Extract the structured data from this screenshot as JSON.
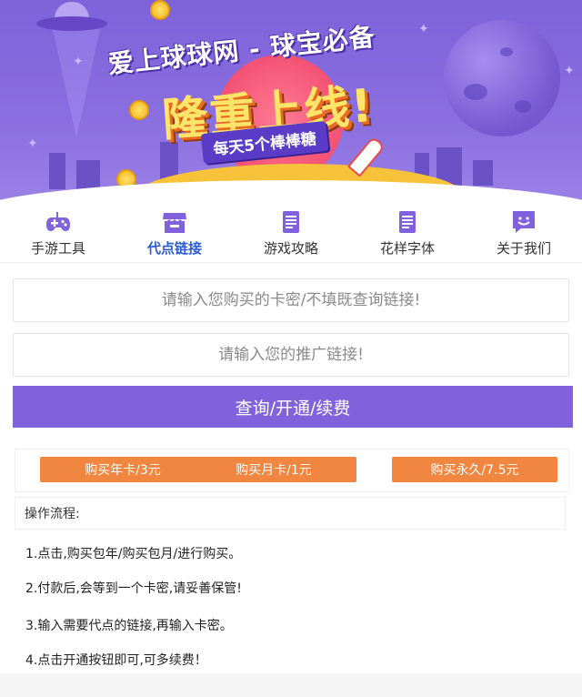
{
  "banner": {
    "title": "爱上球球网 - 球宝必备",
    "headline": "隆重上线!",
    "ribbon": "每天5个棒棒糖"
  },
  "nav": {
    "items": [
      {
        "label": "手游工具",
        "icon": "gamepad-icon",
        "active": false
      },
      {
        "label": "代点链接",
        "icon": "shop-icon",
        "active": true
      },
      {
        "label": "游戏攻略",
        "icon": "document-icon",
        "active": false
      },
      {
        "label": "花样字体",
        "icon": "document-icon",
        "active": false
      },
      {
        "label": "关于我们",
        "icon": "chat-smile-icon",
        "active": false
      }
    ],
    "accent": "#8162dc",
    "active_color": "#2a5bd6"
  },
  "form": {
    "card_placeholder": "请输入您购买的卡密/不填既查询链接!",
    "link_placeholder": "请输入您的推广链接!",
    "submit_label": "查询/开通/续费"
  },
  "purchase": {
    "year_label": "购买年卡/3元",
    "month_label": "购买月卡/1元",
    "forever_label": "购买永久/7.5元",
    "button_color": "#f0863f"
  },
  "steps": {
    "heading": "操作流程:",
    "items": [
      "1.点击,购买包年/购买包月/进行购买。",
      "2.付款后,会等到一个卡密,请妥善保管!",
      "3.输入需要代点的链接,再输入卡密。",
      "4.点击开通按钮即可,可多续费！"
    ]
  }
}
